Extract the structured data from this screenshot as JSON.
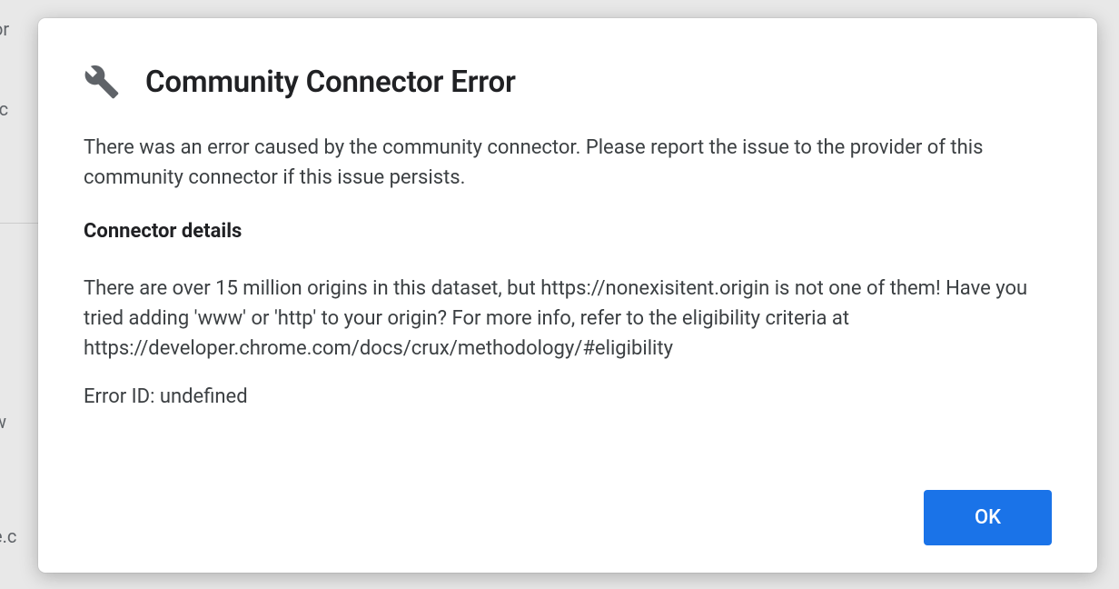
{
  "dialog": {
    "title": "Community Connector Error",
    "intro": "There was an error caused by the community connector. Please report the issue to the provider of this community connector if this issue persists.",
    "details_heading": "Connector details",
    "details_body": "There are over 15 million origins in this dataset, but https://nonexisitent.origin is not one of them! Have you tried adding 'www' or 'http' to your origin? For more info, refer to the eligibility criteria at https://developer.chrome.com/docs/crux/methodology/#eligibility",
    "error_id_line": "Error ID: undefined",
    "ok_label": "OK"
  },
  "background": {
    "frag1": "or",
    "frag2": "rc",
    "frag3": "w",
    "frag4": "e.c"
  }
}
